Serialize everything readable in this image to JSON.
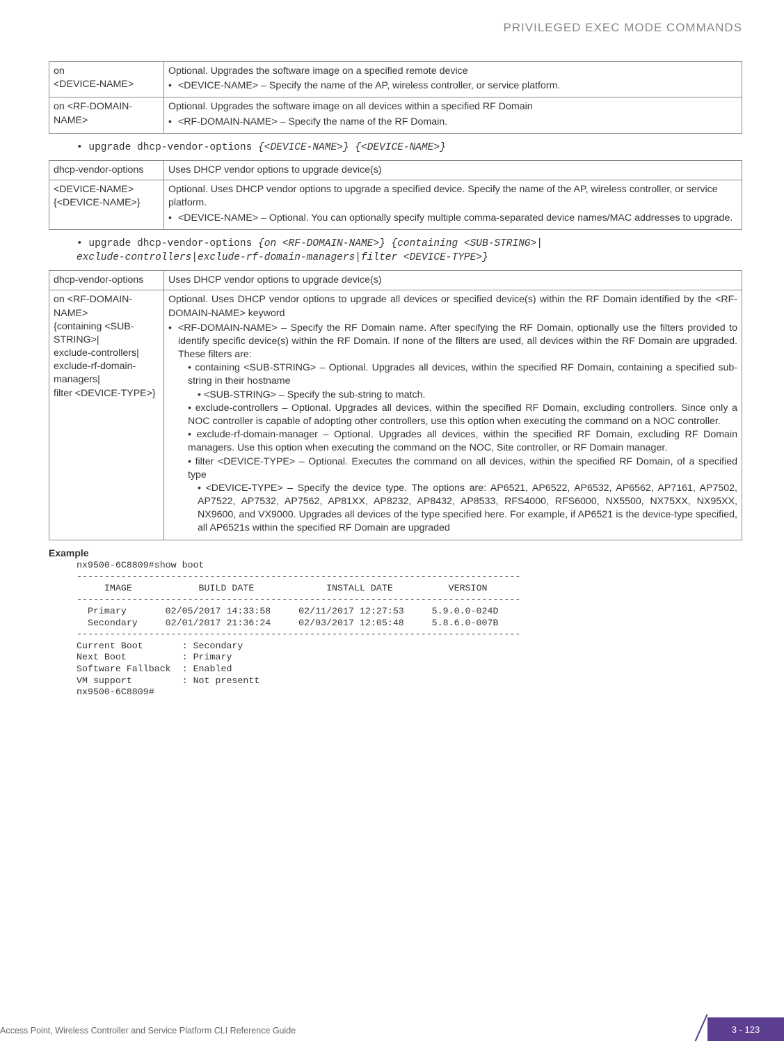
{
  "header": {
    "title": "PRIVILEGED EXEC MODE COMMANDS"
  },
  "table1": {
    "r1c1": "on\n<DEVICE-NAME>",
    "r1c2_p1": "Optional. Upgrades the software image on a specified remote device",
    "r1c2_li": "<DEVICE-NAME> – Specify the name of the AP, wireless controller, or service platform.",
    "r2c1": "on <RF-DOMAIN-NAME>",
    "r2c2_p1": "Optional. Upgrades the software image on all devices within a specified RF Domain",
    "r2c2_li": "<RF-DOMAIN-NAME> – Specify the name of the RF Domain."
  },
  "cmd1": {
    "prefix": "• upgrade dhcp-vendor-options ",
    "args": "{<DEVICE-NAME>} {<DEVICE-NAME>}"
  },
  "table2": {
    "r1c1": "dhcp-vendor-options",
    "r1c2": "Uses DHCP vendor options to upgrade device(s)",
    "r2c1": "<DEVICE-NAME>\n{<DEVICE-NAME>}",
    "r2c2_p1": "Optional. Uses DHCP vendor options to upgrade a specified device. Specify the name of the AP, wireless controller, or service platform.",
    "r2c2_li": "<DEVICE-NAME> – Optional. You can optionally specify multiple comma-separated device names/MAC addresses to upgrade."
  },
  "cmd2": {
    "prefix": "• upgrade dhcp-vendor-options ",
    "args": "{on <RF-DOMAIN-NAME>} {containing <SUB-STRING>|\nexclude-controllers|exclude-rf-domain-managers|filter <DEVICE-TYPE>}"
  },
  "table3": {
    "r1c1": "dhcp-vendor-options",
    "r1c2": "Uses DHCP vendor options to upgrade device(s)",
    "r2c1": "on <RF-DOMAIN-NAME>\n{containing <SUB-STRING>|\nexclude-controllers|\nexclude-rf-domain-managers|\nfilter <DEVICE-TYPE>}",
    "r2c2_p1": "Optional. Uses DHCP vendor options to upgrade all devices or specified device(s) within the RF Domain identified by the <RF-DOMAIN-NAME> keyword",
    "r2c2_li1": "<RF-DOMAIN-NAME> – Specify the RF Domain name. After specifying the RF Domain, optionally use the filters provided to identify specific device(s) within the RF Domain. If none of the filters are used, all devices within the RF Domain are upgraded. These filters are:",
    "r2c2_sub_a": "containing <SUB-STRING> – Optional. Upgrades all devices, within the specified RF Domain, containing a specified sub-string in their hostname",
    "r2c2_sub_a_sub": "<SUB-STRING> – Specify the sub-string to match.",
    "r2c2_sub_b": "exclude-controllers – Optional. Upgrades all devices, within the specified RF Domain, excluding controllers. Since only a NOC controller is capable of adopting other controllers, use this option when executing the command on a NOC controller.",
    "r2c2_sub_c": "exclude-rf-domain-manager – Optional. Upgrades all devices, within the specified RF Domain, excluding RF Domain managers. Use this option when executing the command on the NOC, Site controller, or RF Domain manager.",
    "r2c2_sub_d": "filter <DEVICE-TYPE> – Optional. Executes the command on all devices, within the specified RF Domain, of a specified type",
    "r2c2_sub_d_sub": "<DEVICE-TYPE> – Specify the device type. The options are: AP6521, AP6522, AP6532, AP6562, AP7161, AP7502, AP7522, AP7532, AP7562, AP81XX, AP8232, AP8432, AP8533, RFS4000, RFS6000, NX5500, NX75XX, NX95XX, NX9600, and VX9000. Upgrades all devices of the type specified here. For example, if AP6521 is the device-type specified, all AP6521s within the specified RF Domain are upgraded"
  },
  "example": {
    "label": "Example",
    "text": "nx9500-6C8809#show boot\n--------------------------------------------------------------------------------\n     IMAGE            BUILD DATE             INSTALL DATE          VERSION\n--------------------------------------------------------------------------------\n  Primary       02/05/2017 14:33:58     02/11/2017 12:27:53     5.9.0.0-024D\n  Secondary     02/01/2017 21:36:24     02/03/2017 12:05:48     5.8.6.0-007B\n--------------------------------------------------------------------------------\nCurrent Boot       : Secondary\nNext Boot          : Primary\nSoftware Fallback  : Enabled\nVM support         : Not presentt\nnx9500-6C8809#"
  },
  "footer": {
    "text": "Access Point, Wireless Controller and Service Platform CLI Reference Guide",
    "page": "3 - 123"
  }
}
